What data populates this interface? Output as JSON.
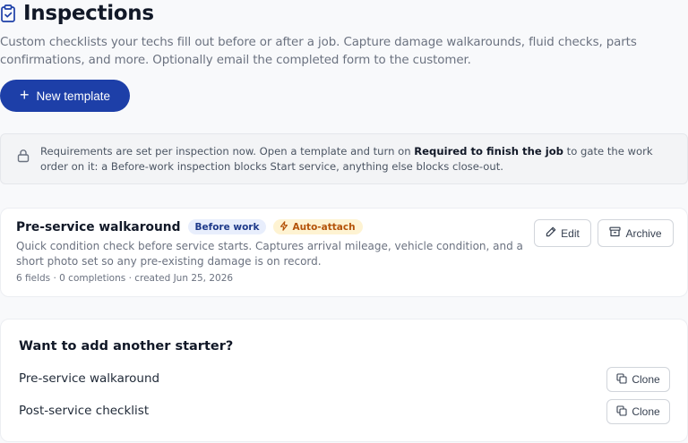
{
  "header": {
    "title": "Inspections",
    "subtitle": "Custom checklists your techs fill out before or after a job. Capture damage walkarounds, fluid checks, parts confirmations, and more. Optionally email the completed form to the customer.",
    "new_template_label": "New template"
  },
  "notice": {
    "text_before": "Requirements are set per inspection now. Open a template and turn on ",
    "text_bold": "Required to finish the job",
    "text_after": " to gate the work order on it: a Before-work inspection blocks Start service, anything else blocks close-out."
  },
  "template_card": {
    "name": "Pre-service walkaround",
    "badge_timing": "Before work",
    "badge_auto": "Auto-attach",
    "description": "Quick condition check before service starts. Captures arrival mileage, vehicle condition, and a short photo set so any pre-existing damage is on record.",
    "meta": "6 fields · 0 completions · created Jun 25, 2026",
    "edit_label": "Edit",
    "archive_label": "Archive"
  },
  "starters": {
    "heading": "Want to add another starter?",
    "items": [
      {
        "label": "Pre-service walkaround",
        "clone_label": "Clone"
      },
      {
        "label": "Post-service checklist",
        "clone_label": "Clone"
      }
    ]
  },
  "colors": {
    "primary": "#1d3fa8",
    "badge_before_bg": "#e8eefc",
    "badge_auto_bg": "#fef3d2",
    "badge_auto_text": "#b45309"
  },
  "icons": [
    "clipboard-check-icon",
    "plus-icon",
    "lock-icon",
    "lightning-icon",
    "pencil-icon",
    "archive-icon",
    "copy-icon"
  ]
}
